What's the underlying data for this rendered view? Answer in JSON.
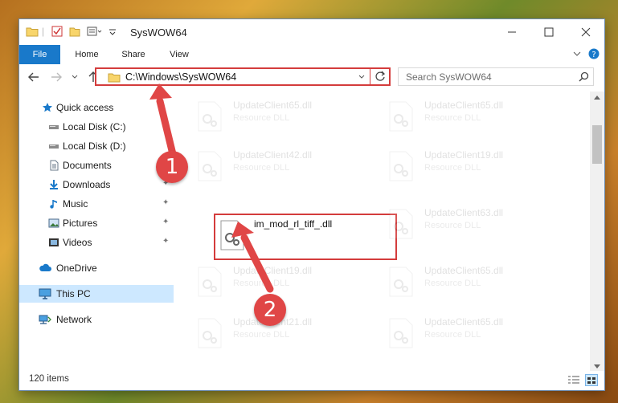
{
  "window": {
    "title": "SysWOW64"
  },
  "ribbon": {
    "tabs": [
      "File",
      "Home",
      "Share",
      "View"
    ]
  },
  "address": {
    "path": "C:\\Windows\\SysWOW64"
  },
  "search": {
    "placeholder": "Search SysWOW64"
  },
  "navigation": {
    "items": [
      {
        "label": "Quick access",
        "icon": "star-icon"
      },
      {
        "label": "Local Disk (C:)",
        "icon": "drive-icon"
      },
      {
        "label": "Local Disk (D:)",
        "icon": "drive-icon"
      },
      {
        "label": "Documents",
        "icon": "documents-icon"
      },
      {
        "label": "Downloads",
        "icon": "download-icon"
      },
      {
        "label": "Music",
        "icon": "music-icon"
      },
      {
        "label": "Pictures",
        "icon": "pictures-icon"
      },
      {
        "label": "Videos",
        "icon": "videos-icon"
      },
      {
        "label": "OneDrive",
        "icon": "cloud-icon"
      },
      {
        "label": "This PC",
        "icon": "computer-icon"
      },
      {
        "label": "Network",
        "icon": "network-icon"
      }
    ]
  },
  "files": {
    "highlighted": {
      "name": "im_mod_rl_tiff_.dll"
    },
    "tiles": [
      {
        "name": "UpdateClient65.dll",
        "type": "Resource DLL"
      },
      {
        "name": "UpdateClient65.dll",
        "type": "Resource DLL"
      },
      {
        "name": "UpdateClient42.dll",
        "type": "Resource DLL"
      },
      {
        "name": "UpdateClient19.dll",
        "type": "Resource DLL"
      },
      {
        "name": "UpdateClient63.dll",
        "type": "Resource DLL"
      },
      {
        "name": "UpdateClient19.dll",
        "type": "Resource DLL"
      },
      {
        "name": "UpdateClient65.dll",
        "type": "Resource DLL"
      },
      {
        "name": "UpdateClient21.dll",
        "type": "Resource DLL"
      },
      {
        "name": "UpdateClient65.dll",
        "type": "Resource DLL"
      }
    ]
  },
  "status": {
    "count": "120 items"
  },
  "annotations": {
    "badge1": "1",
    "badge2": "2"
  },
  "colors": {
    "accent": "#1979ca",
    "highlight": "#d43c3c",
    "selection": "#cde8ff"
  }
}
